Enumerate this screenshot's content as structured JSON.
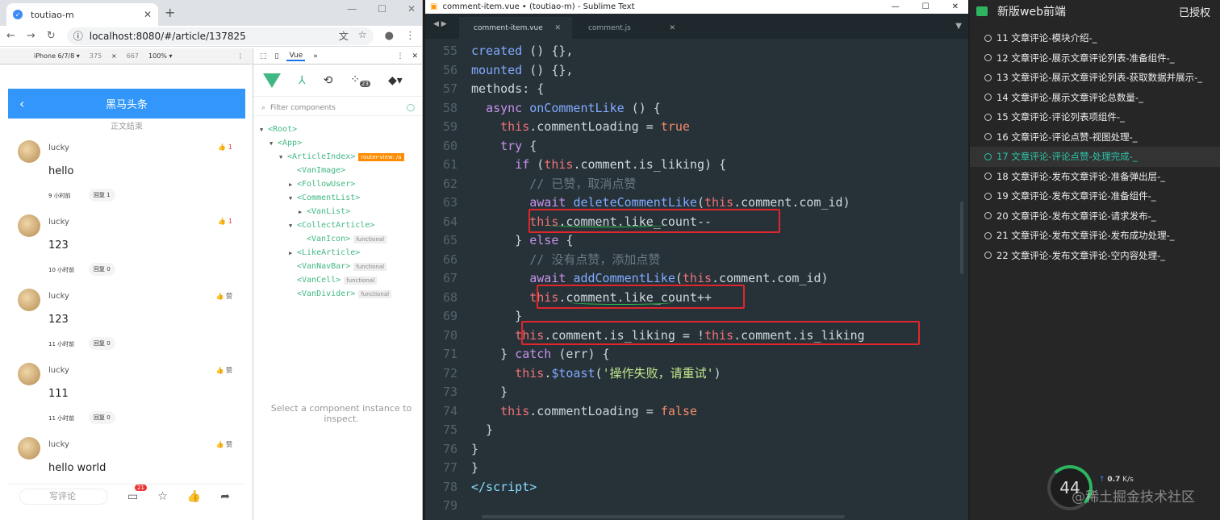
{
  "chrome": {
    "tab_title": "toutiao-m",
    "url": "localhost:8080/#/article/137825",
    "device": "iPhone 6/7/8 ▾",
    "width": "375",
    "times": "×",
    "height": "667",
    "zoom": "100% ▾"
  },
  "mobile": {
    "nav_title": "黑马头条",
    "end_text": "正文结束",
    "comments": [
      {
        "name": "lucky",
        "content": "hello",
        "time": "9 小时前",
        "reply": "回复 1",
        "likes": "👍 1"
      },
      {
        "name": "lucky",
        "content": "123",
        "time": "10 小时前",
        "reply": "回复 0",
        "likes": "👍 1"
      },
      {
        "name": "lucky",
        "content": "123",
        "time": "11 小时前",
        "reply": "回复 0",
        "likes": "👍 赞"
      },
      {
        "name": "lucky",
        "content": "111",
        "time": "11 小时前",
        "reply": "回复 0",
        "likes": "👍 赞"
      },
      {
        "name": "lucky",
        "content": "hello world",
        "time": "",
        "reply": "",
        "likes": "👍 赞"
      }
    ],
    "write_comment": "写评论",
    "comment_badge": "21"
  },
  "devtools": {
    "panel_tab": "Vue",
    "filter_placeholder": "Filter components",
    "badge": "23",
    "tree": [
      {
        "label": "<Root>",
        "indent": 0,
        "arrow": "▼"
      },
      {
        "label": "<App>",
        "indent": 1,
        "arrow": "▼"
      },
      {
        "label": "<ArticleIndex>",
        "indent": 2,
        "arrow": "▼",
        "tag": "router-view: /a"
      },
      {
        "label": "<VanImage>",
        "indent": 3,
        "arrow": ""
      },
      {
        "label": "<FollowUser>",
        "indent": 3,
        "arrow": "▶"
      },
      {
        "label": "<CommentList>",
        "indent": 3,
        "arrow": "▼"
      },
      {
        "label": "<VanList>",
        "indent": 4,
        "arrow": "▶"
      },
      {
        "label": "<CollectArticle>",
        "indent": 3,
        "arrow": "▼"
      },
      {
        "label": "<VanIcon>",
        "indent": 4,
        "arrow": "",
        "tag": "functional"
      },
      {
        "label": "<LikeArticle>",
        "indent": 3,
        "arrow": "▶"
      },
      {
        "label": "<VanNavBar>",
        "indent": 3,
        "arrow": "",
        "tag": "functional"
      },
      {
        "label": "<VanCell>",
        "indent": 3,
        "arrow": "",
        "tag": "functional"
      },
      {
        "label": "<VanDivider>",
        "indent": 3,
        "arrow": "",
        "tag": "functional"
      }
    ],
    "select_message": "Select a component instance to inspect."
  },
  "sublime": {
    "window_title": "comment-item.vue • (toutiao-m) - Sublime Text",
    "tabs": [
      "comment-item.vue",
      "comment.js"
    ],
    "line_numbers": [
      "55",
      "56",
      "57",
      "58",
      "59",
      "60",
      "61",
      "62",
      "63",
      "64",
      "65",
      "66",
      "67",
      "68",
      "69",
      "70",
      "71",
      "72",
      "73",
      "74",
      "75",
      "76",
      "77",
      "78",
      "79"
    ]
  },
  "course": {
    "title": "新版web前端",
    "auth": "已授权",
    "lessons": [
      "11 文章评论-模块介绍-_",
      "12 文章评论-展示文章评论列表-准备组件-_",
      "13 文章评论-展示文章评论列表-获取数据并展示-_",
      "14 文章评论-展示文章评论总数量-_",
      "15 文章评论-评论列表项组件-_",
      "16 文章评论-评论点赞-视图处理-_",
      "17 文章评论-评论点赞-处理完成-_",
      "18 文章评论-发布文章评论-准备弹出层-_",
      "19 文章评论-发布文章评论-准备组件-_",
      "20 文章评论-发布文章评论-请求发布-_",
      "21 文章评论-发布文章评论-发布成功处理-_",
      "22 文章评论-发布文章评论-空内容处理-_"
    ],
    "current_index": 6,
    "gauge": "44",
    "speed_up": "0.7",
    "speed_unit": "K/s",
    "watermark": "@稀土掘金技术社区"
  },
  "colors": {
    "accent_blue": "#3296fa",
    "sublime_bg": "#263238",
    "highlight_red": "#e0262b",
    "vue_green": "#41b883"
  }
}
